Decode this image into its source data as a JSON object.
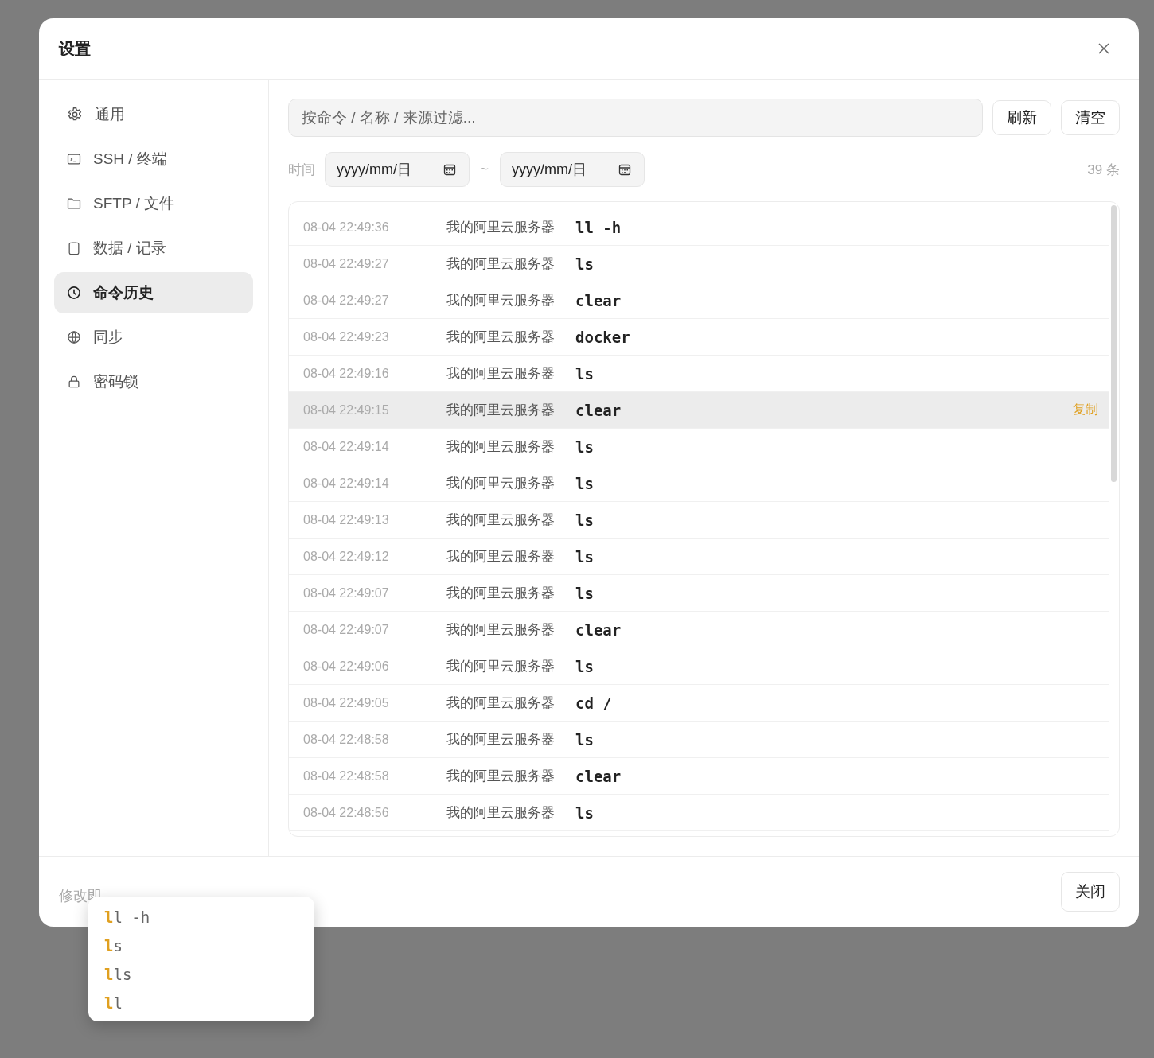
{
  "dialog": {
    "title": "设置",
    "footer_note": "修改即",
    "close_button": "关闭"
  },
  "sidebar": {
    "items": [
      {
        "label": "SSH / 终端",
        "selected": false
      },
      {
        "label": "SFTP / 文件",
        "selected": false
      },
      {
        "label": "数据 / 记录",
        "selected": false
      },
      {
        "label": "命令历史",
        "selected": true
      },
      {
        "label": "同步",
        "selected": false
      },
      {
        "label": "密码锁",
        "selected": false
      }
    ],
    "first_item": {
      "label": "通用",
      "selected": false
    }
  },
  "filter": {
    "placeholder": "按命令 / 名称 / 来源过滤...",
    "refresh_button": "刷新",
    "clear_button": "清空"
  },
  "date_range": {
    "label": "时间",
    "from": "yyyy/mm/日",
    "separator": "~",
    "to": "yyyy/mm/日",
    "count": "39 条"
  },
  "history": [
    {
      "time": "08-04 22:49:36",
      "server": "我的阿里云服务器",
      "command": "ll -h",
      "hovered": false
    },
    {
      "time": "08-04 22:49:27",
      "server": "我的阿里云服务器",
      "command": "ls",
      "hovered": false
    },
    {
      "time": "08-04 22:49:27",
      "server": "我的阿里云服务器",
      "command": "clear",
      "hovered": false
    },
    {
      "time": "08-04 22:49:23",
      "server": "我的阿里云服务器",
      "command": "docker",
      "hovered": false
    },
    {
      "time": "08-04 22:49:16",
      "server": "我的阿里云服务器",
      "command": "ls",
      "hovered": false
    },
    {
      "time": "08-04 22:49:15",
      "server": "我的阿里云服务器",
      "command": "clear",
      "hovered": true,
      "action": "复制"
    },
    {
      "time": "08-04 22:49:14",
      "server": "我的阿里云服务器",
      "command": "ls",
      "hovered": false
    },
    {
      "time": "08-04 22:49:14",
      "server": "我的阿里云服务器",
      "command": "ls",
      "hovered": false
    },
    {
      "time": "08-04 22:49:13",
      "server": "我的阿里云服务器",
      "command": "ls",
      "hovered": false
    },
    {
      "time": "08-04 22:49:12",
      "server": "我的阿里云服务器",
      "command": "ls",
      "hovered": false
    },
    {
      "time": "08-04 22:49:07",
      "server": "我的阿里云服务器",
      "command": "ls",
      "hovered": false
    },
    {
      "time": "08-04 22:49:07",
      "server": "我的阿里云服务器",
      "command": "clear",
      "hovered": false
    },
    {
      "time": "08-04 22:49:06",
      "server": "我的阿里云服务器",
      "command": "ls",
      "hovered": false
    },
    {
      "time": "08-04 22:49:05",
      "server": "我的阿里云服务器",
      "command": "cd /",
      "hovered": false
    },
    {
      "time": "08-04 22:48:58",
      "server": "我的阿里云服务器",
      "command": "ls",
      "hovered": false
    },
    {
      "time": "08-04 22:48:58",
      "server": "我的阿里云服务器",
      "command": "clear",
      "hovered": false
    },
    {
      "time": "08-04 22:48:56",
      "server": "我的阿里云服务器",
      "command": "ls",
      "hovered": false
    }
  ],
  "suggestions": [
    "**l**l -h",
    "**l**s",
    "**l**ls",
    "**l**l"
  ]
}
